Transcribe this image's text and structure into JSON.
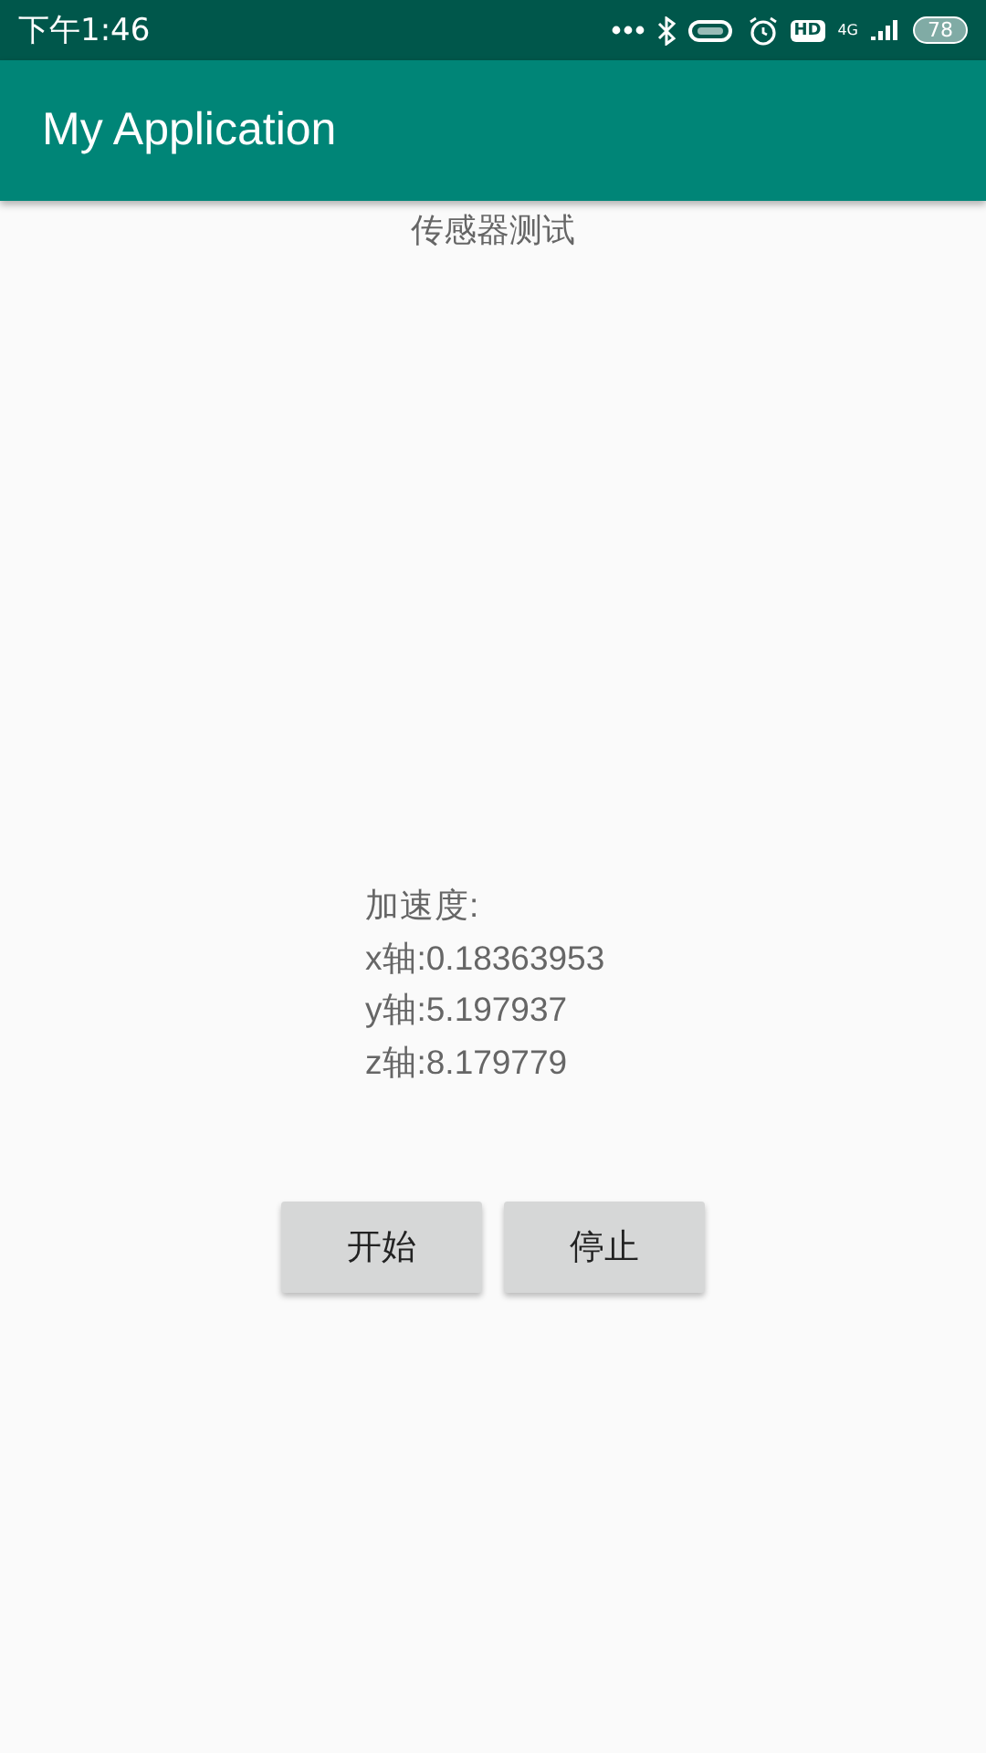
{
  "status_bar": {
    "time": "下午1:46",
    "hd": "HD",
    "network": "4G",
    "battery": "78"
  },
  "app_bar": {
    "title": "My Application"
  },
  "heading": "传感器测试",
  "readings": [
    "加速度:",
    "x轴:0.18363953",
    "y轴:5.197937",
    "z轴:8.179779"
  ],
  "buttons": [
    "开始",
    "停止"
  ]
}
